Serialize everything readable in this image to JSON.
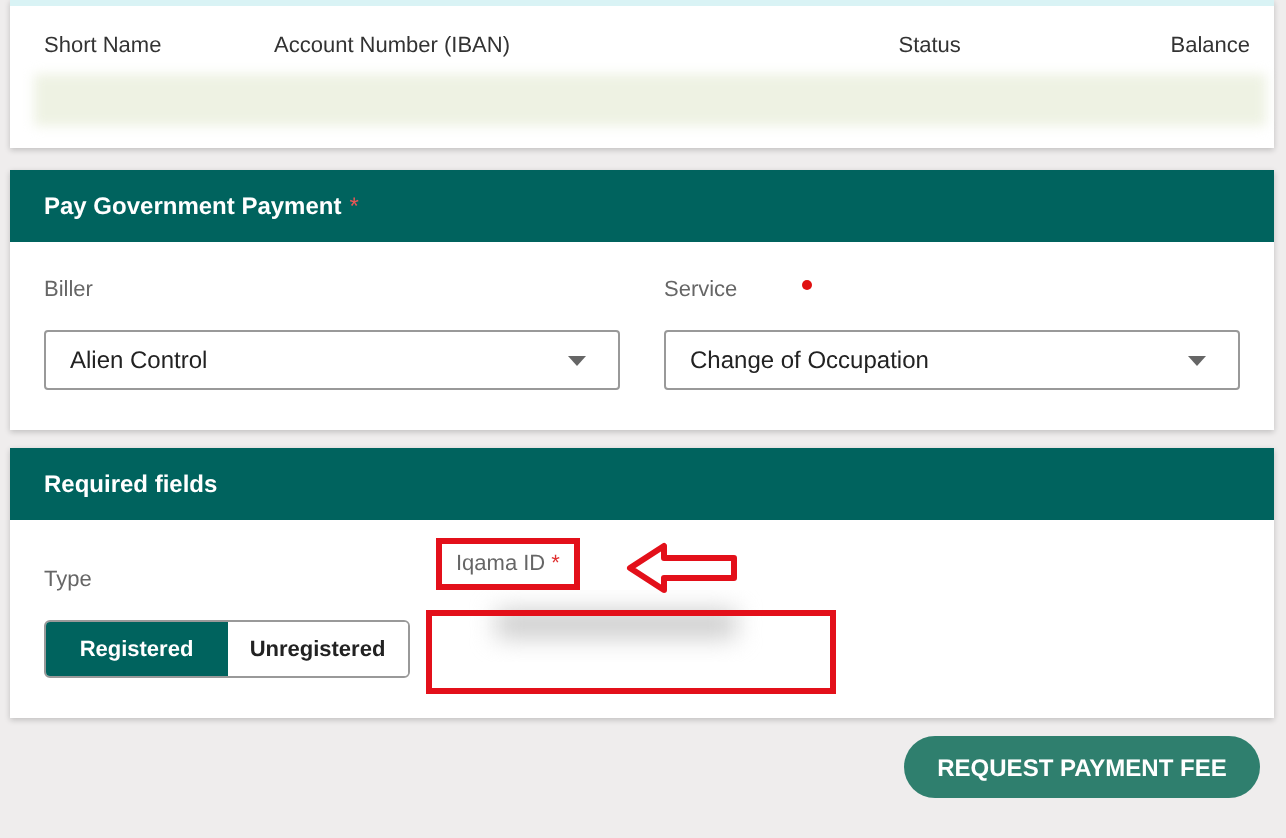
{
  "accounts_table": {
    "columns": [
      "Short Name",
      "Account Number (IBAN)",
      "Status",
      "Balance"
    ]
  },
  "payment_section": {
    "title": "Pay Government Payment",
    "required_mark": "*",
    "fields": [
      {
        "label": "Biller",
        "value": "Alien Control",
        "required_dot": false
      },
      {
        "label": "Service",
        "value": "Change of Occupation",
        "required_dot": true
      }
    ]
  },
  "required_section": {
    "title": "Required fields",
    "type_label": "Type",
    "type_options": [
      {
        "label": "Registered",
        "selected": true
      },
      {
        "label": "Unregistered",
        "selected": false
      }
    ],
    "iqama_label": "Iqama ID",
    "iqama_required_mark": "*"
  },
  "submit_button": "REQUEST PAYMENT FEE"
}
